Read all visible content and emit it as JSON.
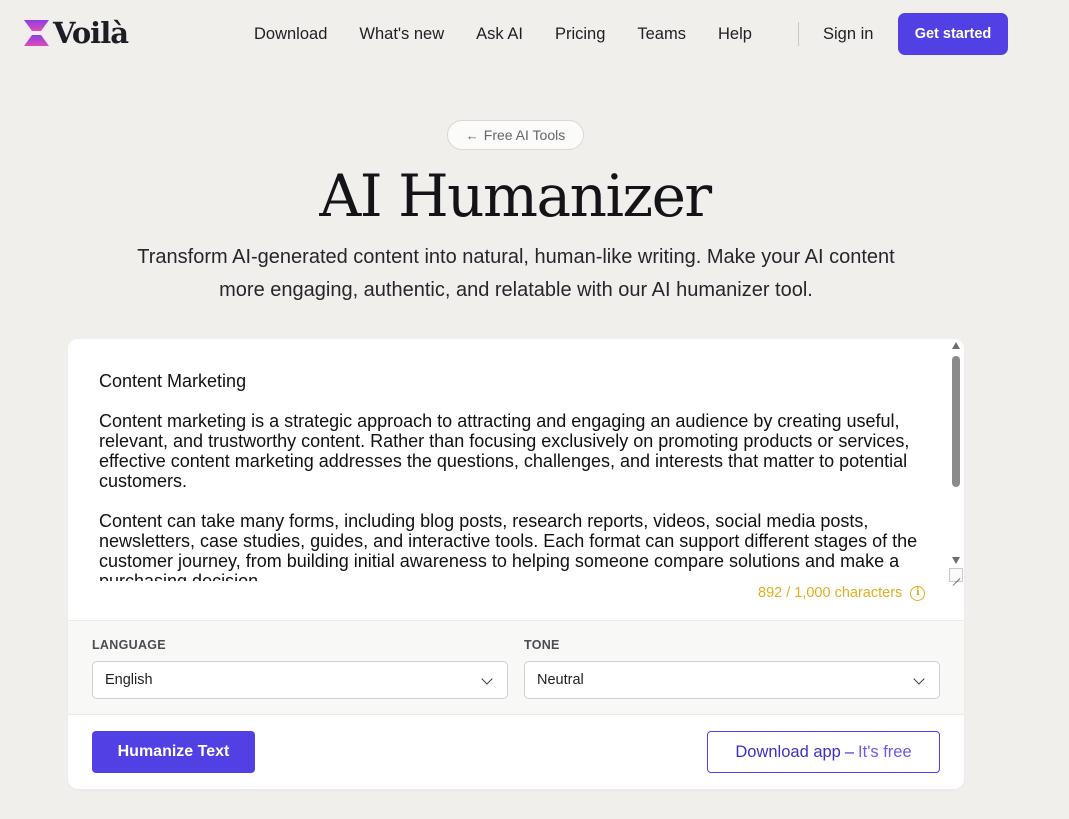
{
  "brand": {
    "name": "Voilà",
    "colors": {
      "accent": "#5140e3",
      "logo_top": "#8b3fe6",
      "logo_bottom": "#e24bb6",
      "warning": "#e0ae1d",
      "background": "#f0efec"
    }
  },
  "nav": {
    "links": [
      "Download",
      "What's new",
      "Ask AI",
      "Pricing",
      "Teams",
      "Help"
    ],
    "sign_in": "Sign in",
    "cta": "Get started"
  },
  "hero": {
    "back_link": "Free AI Tools",
    "back_icon": "arrow-left-icon",
    "title": "AI Humanizer",
    "subtitle": "Transform AI-generated content into natural, human-like writing. Make your AI content more engaging, authentic, and relatable with our AI humanizer tool."
  },
  "editor": {
    "paragraphs": [
      "Content Marketing",
      "Content marketing is a strategic approach to attracting and engaging an audience by creating useful, relevant, and trustworthy content. Rather than focusing exclusively on promoting products or services, effective content marketing addresses the questions, challenges, and interests that matter to potential customers.",
      "Content can take many forms, including blog posts, research reports, videos, social media posts, newsletters, case studies, guides, and interactive tools. Each format can support different stages of the customer journey, from building initial awareness to helping someone compare solutions and make a purchasing decision."
    ],
    "char_count": "892 / 1,000 characters",
    "info_icon": "info-icon"
  },
  "options": {
    "language_label": "LANGUAGE",
    "language_value": "English",
    "tone_label": "TONE",
    "tone_value": "Neutral"
  },
  "actions": {
    "humanize": "Humanize Text",
    "download_main": "Download app",
    "download_dash": "–",
    "download_free": "It's free"
  }
}
